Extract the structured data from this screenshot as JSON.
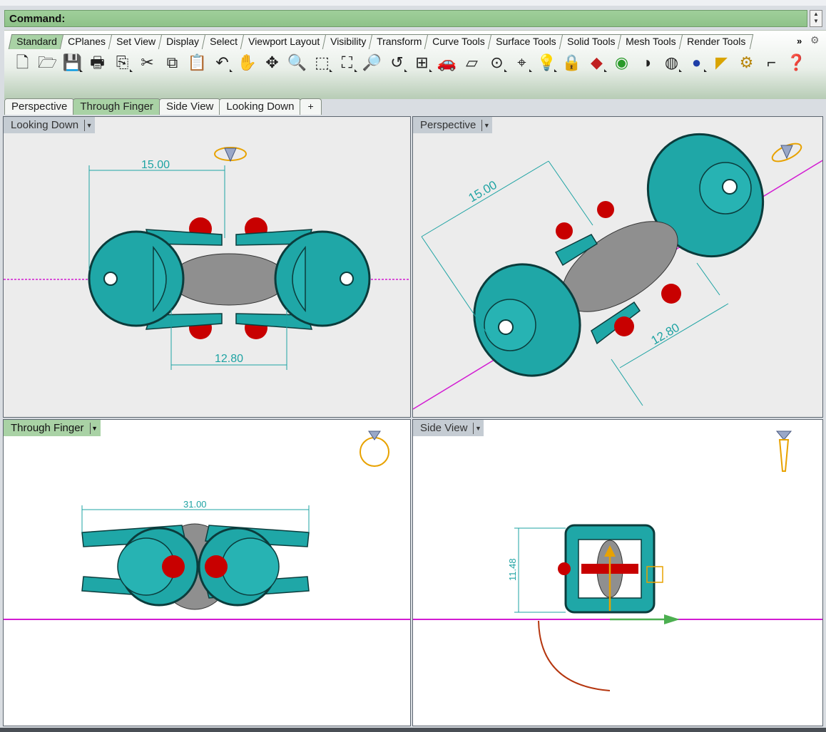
{
  "command": {
    "label": "Command:"
  },
  "toolbar_tabs": [
    "Standard",
    "CPlanes",
    "Set View",
    "Display",
    "Select",
    "Viewport Layout",
    "Visibility",
    "Transform",
    "Curve Tools",
    "Surface Tools",
    "Solid Tools",
    "Mesh Tools",
    "Render Tools"
  ],
  "toolbar_more": "»",
  "viewport_tabs": [
    "Perspective",
    "Through Finger",
    "Side View",
    "Looking Down"
  ],
  "viewport_tab_add": "+",
  "viewports": {
    "top_left": {
      "title": "Looking Down",
      "dim_a": "15.00",
      "dim_b": "12.80"
    },
    "top_right": {
      "title": "Perspective",
      "dim_a": "15.00",
      "dim_b": "12.80"
    },
    "bottom_left": {
      "title": "Through Finger",
      "dim_a": "31.00"
    },
    "bottom_right": {
      "title": "Side View",
      "dim_a": "11.48"
    }
  },
  "colors": {
    "cyan": "#1fa7a7",
    "cyan_dark": "#0f5f5f",
    "red": "#c00000",
    "grey": "#8a8a8a",
    "magenta": "#d21bd2",
    "dimension": "#1ea3a3",
    "active_green": "#a9d2a5"
  }
}
